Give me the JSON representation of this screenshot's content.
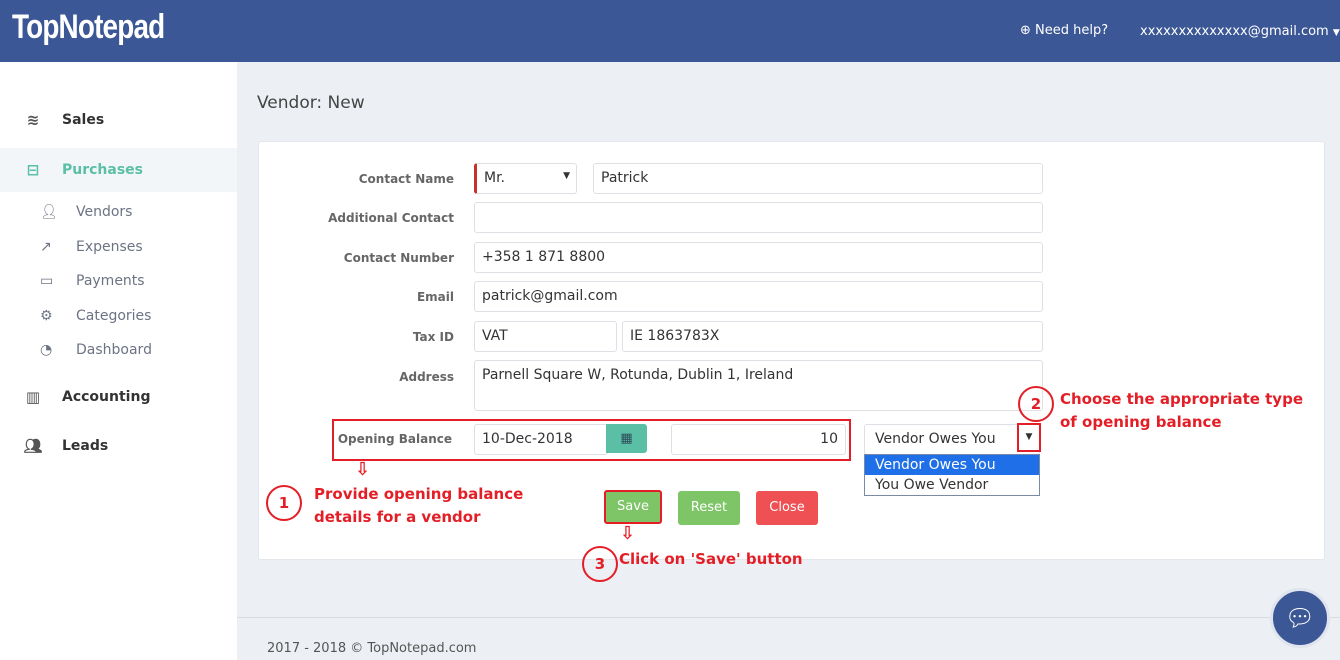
{
  "header": {
    "logo": "TopNotepad",
    "help": "Need help?",
    "user": "xxxxxxxxxxxxxx@gmail.com",
    "color": "#3b5795"
  },
  "sidebar": {
    "items": [
      {
        "label": "Sales",
        "icon": "layers-icon"
      },
      {
        "label": "Purchases",
        "icon": "minus-square-icon",
        "active": true
      },
      {
        "label": "Accounting",
        "icon": "bar-chart-icon"
      },
      {
        "label": "Leads",
        "icon": "users-icon"
      }
    ],
    "sub": [
      {
        "label": "Vendors",
        "icon": "user-icon"
      },
      {
        "label": "Expenses",
        "icon": "share-icon"
      },
      {
        "label": "Payments",
        "icon": "credit-card-icon"
      },
      {
        "label": "Categories",
        "icon": "gear-icon"
      },
      {
        "label": "Dashboard",
        "icon": "dashboard-icon"
      }
    ]
  },
  "page": {
    "title": "Vendor: New"
  },
  "form": {
    "contact_name": {
      "label": "Contact Name",
      "salutation": "Mr.",
      "value": "Patrick"
    },
    "additional_contact": {
      "label": "Additional Contact",
      "value": ""
    },
    "contact_number": {
      "label": "Contact Number",
      "value": "+358 1 871 8800"
    },
    "email": {
      "label": "Email",
      "value": "patrick@gmail.com"
    },
    "tax_id": {
      "label": "Tax ID",
      "type": "VAT",
      "value": "IE 1863783X"
    },
    "address": {
      "label": "Address",
      "value": "Parnell Square W, Rotunda, Dublin 1, Ireland"
    },
    "opening_balance": {
      "label": "Opening Balance",
      "date": "10-Dec-2018",
      "amount": "10",
      "type": "Vendor Owes You",
      "options": [
        "Vendor Owes You",
        "You Owe Vendor"
      ]
    },
    "buttons": {
      "save": "Save",
      "reset": "Reset",
      "close": "Close"
    }
  },
  "annotations": {
    "n1": "1",
    "t1a": "Provide opening balance",
    "t1b": "details for a vendor",
    "n2": "2",
    "t2a": "Choose the appropriate type",
    "t2b": "of opening balance",
    "n3": "3",
    "t3": "Click on 'Save' button"
  },
  "footer": "2017 - 2018 © TopNotepad.com"
}
